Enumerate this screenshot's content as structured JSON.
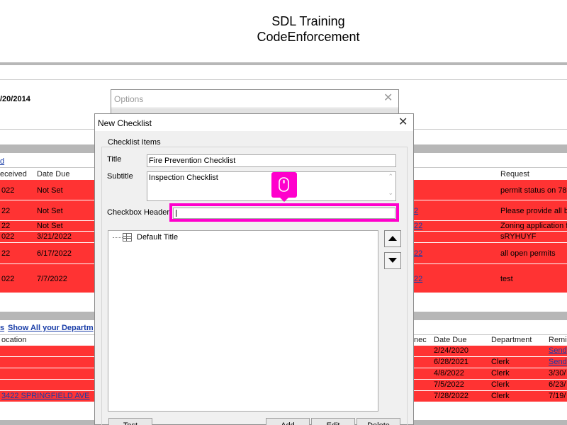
{
  "app": {
    "title_line1": "SDL Training",
    "title_line2": "CodeEnforcement"
  },
  "background": {
    "date_fragment": "/20/2014",
    "link_fragment": "d",
    "table1": {
      "headers": [
        "eceived",
        "Date Due",
        "Request"
      ],
      "rows": [
        {
          "received": "022",
          "due": "Not Set",
          "link": "",
          "request": "permit status on 78"
        },
        {
          "received": "22",
          "due": "Not Set",
          "link": "2",
          "request": "Please provide all b"
        },
        {
          "received": "22",
          "due": "Not Set",
          "link": "22",
          "request": "Zoning application f"
        },
        {
          "received": "022",
          "due": "3/21/2022",
          "link": "",
          "request": "sRYHUYF"
        },
        {
          "received": "22",
          "due": "6/17/2022",
          "link": "22",
          "request": "all open permits"
        },
        {
          "received": "022",
          "due": "7/7/2022",
          "link": "22",
          "request": "test"
        }
      ]
    },
    "table2": {
      "links": [
        "s",
        "Show All your Departm"
      ],
      "headers": [
        "ocation",
        "nec",
        "Date Due",
        "Department",
        "Remi"
      ],
      "rows": [
        {
          "location": "",
          "due": "2/24/2020",
          "dept": "",
          "remind": "Send"
        },
        {
          "location": "",
          "due": "6/28/2021",
          "dept": "Clerk",
          "remind": "Send"
        },
        {
          "location": "",
          "due": "4/8/2022",
          "dept": "Clerk",
          "remind": "3/30/"
        },
        {
          "location": "",
          "due": "7/5/2022",
          "dept": "Clerk",
          "remind": "6/23/"
        },
        {
          "location": "3422 SPRINGFIELD AVE",
          "due": "7/28/2022",
          "dept": "Clerk",
          "remind": "7/19/"
        }
      ]
    }
  },
  "options_window": {
    "title": "Options"
  },
  "dialog": {
    "title": "New Checklist",
    "group_label": "Checklist Items",
    "title_label": "Title",
    "title_value": "Fire Prevention Checklist",
    "subtitle_label": "Subtitle",
    "subtitle_value": "Inspection Checklist",
    "checkbox_header_label": "Checkbox Header",
    "checkbox_header_value": "",
    "tree_root": "Default Title",
    "buttons": {
      "test": "Test",
      "add": "Add",
      "edit": "Edit",
      "delete": "Delete"
    }
  },
  "colors": {
    "highlight": "#ff00cc",
    "row_red": "#ff3333",
    "band_gray": "#b7b7b7",
    "link_blue": "#1a3ea8"
  },
  "icons": {
    "cursor": "mouse-click-icon",
    "up": "arrow-up-icon",
    "down": "arrow-down-icon",
    "tree": "table-icon"
  }
}
